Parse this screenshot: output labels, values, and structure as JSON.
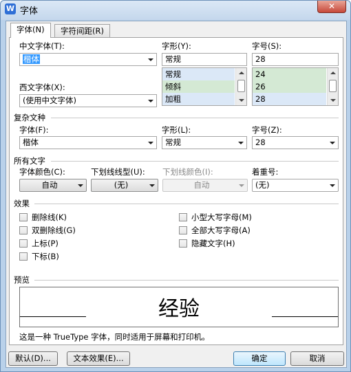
{
  "window": {
    "title": "字体",
    "app_icon": "W",
    "close_glyph": "✕"
  },
  "tabs": [
    {
      "label": "字体(N)"
    },
    {
      "label": "字符间距(R)"
    }
  ],
  "chinese_font": {
    "label": "中文字体(T):",
    "value": "楷体"
  },
  "style": {
    "label": "字形(Y):",
    "value": "常规",
    "options": [
      "常规",
      "倾斜",
      "加粗"
    ]
  },
  "size": {
    "label": "字号(S):",
    "value": "28",
    "options": [
      "24",
      "26",
      "28"
    ]
  },
  "western_font": {
    "label": "西文字体(X):",
    "value": "(使用中文字体)"
  },
  "complex": {
    "group_label": "复杂文种",
    "font_label": "字体(F):",
    "font_value": "楷体",
    "style_label": "字形(L):",
    "style_value": "常规",
    "size_label": "字号(Z):",
    "size_value": "28"
  },
  "all_text": {
    "group_label": "所有文字",
    "color_label": "字体颜色(C):",
    "color_value": "自动",
    "underline_label": "下划线线型(U):",
    "underline_value": "(无)",
    "underline_color_label": "下划线颜色(I):",
    "underline_color_value": "自动",
    "emphasis_label": "着重号:",
    "emphasis_value": "(无)"
  },
  "effects": {
    "group_label": "效果",
    "left": [
      "删除线(K)",
      "双删除线(G)",
      "上标(P)",
      "下标(B)"
    ],
    "right": [
      "小型大写字母(M)",
      "全部大写字母(A)",
      "隐藏文字(H)"
    ]
  },
  "preview": {
    "group_label": "预览",
    "sample": "经验",
    "note": "这是一种 TrueType 字体，同时适用于屏幕和打印机。"
  },
  "buttons": {
    "default": "默认(D)...",
    "text_effects": "文本效果(E)...",
    "ok": "确定",
    "cancel": "取消"
  }
}
